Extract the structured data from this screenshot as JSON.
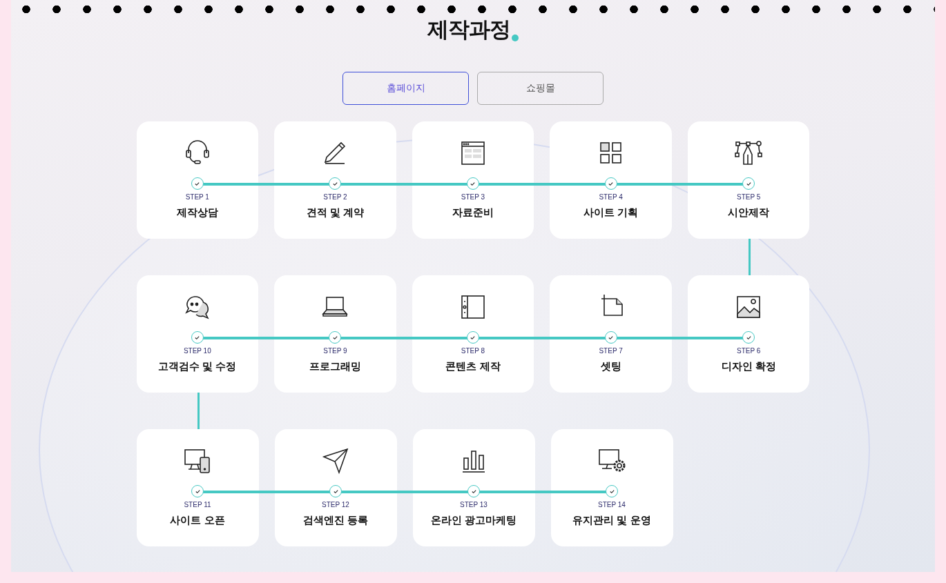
{
  "title": "제작과정",
  "tabs": [
    {
      "label": "홈페이지",
      "selected": true
    },
    {
      "label": "쇼핑몰",
      "selected": false
    }
  ],
  "rows": [
    {
      "steps": [
        {
          "step": "STEP 1",
          "name": "제작상담"
        },
        {
          "step": "STEP 2",
          "name": "견적 및 계약"
        },
        {
          "step": "STEP 3",
          "name": "자료준비"
        },
        {
          "step": "STEP 4",
          "name": "사이트 기획"
        },
        {
          "step": "STEP 5",
          "name": "시안제작"
        }
      ]
    },
    {
      "steps": [
        {
          "step": "STEP 10",
          "name": "고객검수 및 수정"
        },
        {
          "step": "STEP 9",
          "name": "프로그래밍"
        },
        {
          "step": "STEP 8",
          "name": "콘텐츠 제작"
        },
        {
          "step": "STEP 7",
          "name": "셋팅"
        },
        {
          "step": "STEP 6",
          "name": "디자인 확정"
        }
      ]
    },
    {
      "steps": [
        {
          "step": "STEP 11",
          "name": "사이트 오픈"
        },
        {
          "step": "STEP 12",
          "name": "검색엔진 등록"
        },
        {
          "step": "STEP 13",
          "name": "온라인 광고마케팅"
        },
        {
          "step": "STEP 14",
          "name": "유지관리 및 운영"
        }
      ]
    }
  ]
}
